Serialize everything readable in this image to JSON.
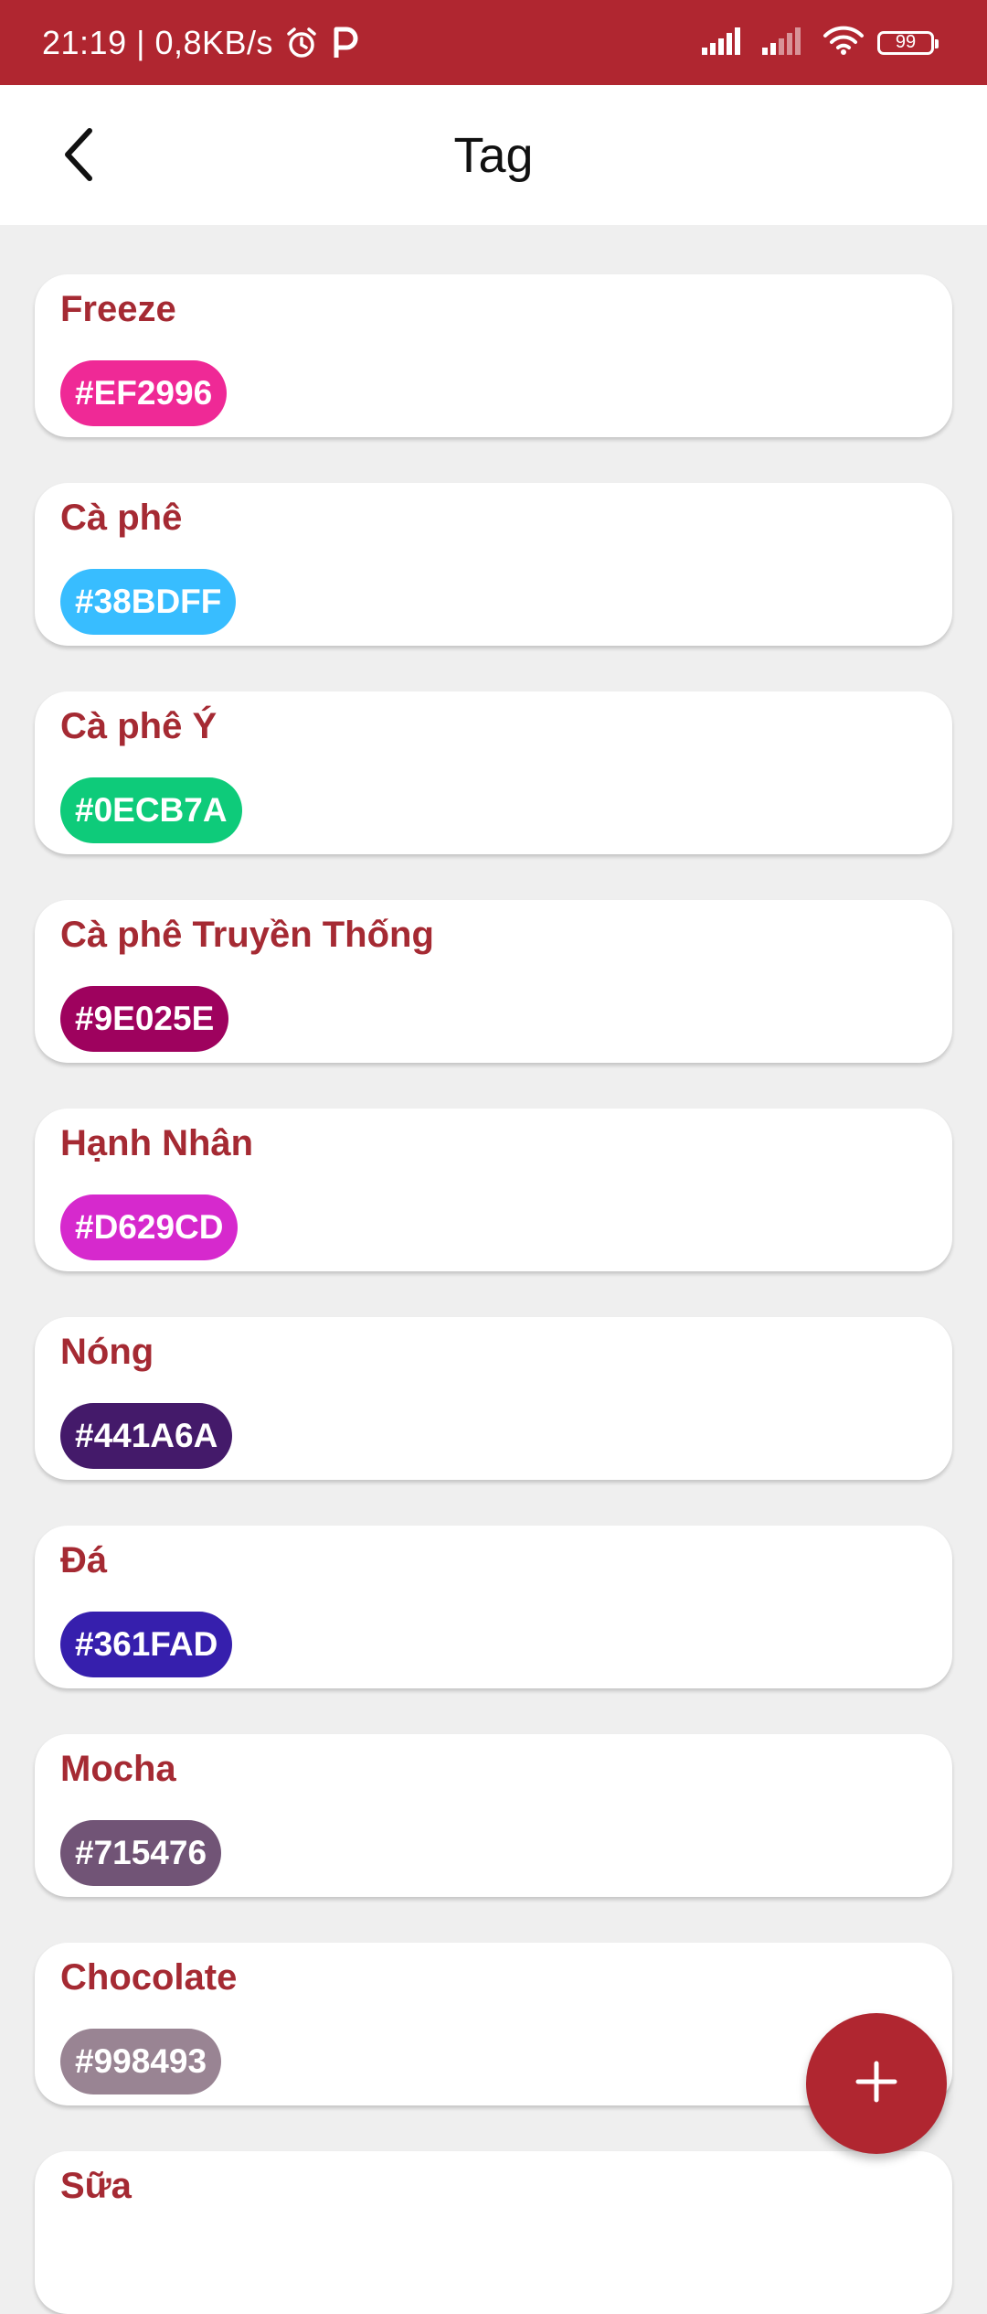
{
  "status_bar": {
    "text": "21:19 | 0,8KB/s",
    "battery": "99"
  },
  "header": {
    "title": "Tag"
  },
  "tags": [
    {
      "name": "Freeze",
      "code": "#EF2996",
      "color": "#EF2996"
    },
    {
      "name": "Cà phê",
      "code": "#38BDFF",
      "color": "#38BDFF"
    },
    {
      "name": "Cà phê Ý",
      "code": "#0ECB7A",
      "color": "#0ECB7A"
    },
    {
      "name": "Cà phê Truyền Thống",
      "code": "#9E025E",
      "color": "#9E025E"
    },
    {
      "name": "Hạnh Nhân",
      "code": "#D629CD",
      "color": "#D629CD"
    },
    {
      "name": "Nóng",
      "code": "#441A6A",
      "color": "#441A6A"
    },
    {
      "name": "Đá",
      "code": "#361FAD",
      "color": "#361FAD"
    },
    {
      "name": "Mocha",
      "code": "#715476",
      "color": "#715476"
    },
    {
      "name": "Chocolate",
      "code": "#998493",
      "color": "#998493"
    },
    {
      "name": "Sữa",
      "code": "",
      "color": ""
    }
  ],
  "colors": {
    "accent": "#B02630",
    "tag_name": "#A52A33",
    "background": "#EFEFEF"
  },
  "icons": {
    "back": "chevron-left-icon",
    "fab": "plus-icon"
  }
}
